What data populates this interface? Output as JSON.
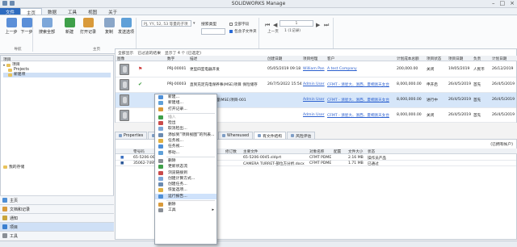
{
  "window": {
    "title": "SOLIDWORKS Manage"
  },
  "menu": [
    "文件",
    "主页",
    "数据",
    "工具",
    "视图",
    "关于"
  ],
  "ribbon": {
    "buttons": [
      {
        "label": "上一步"
      },
      {
        "label": "下一步"
      },
      {
        "label": "搜索全部"
      },
      {
        "label": "新建"
      },
      {
        "label": "打开记录"
      },
      {
        "label": "复制"
      },
      {
        "label": "发送选项"
      }
    ],
    "groups": [
      "导航",
      "主页"
    ],
    "search_value": "PJ, YY, 52, 53 等量的子项",
    "search_type_label": "搜索类型",
    "search_checks": [
      {
        "label": "全部字段",
        "checked": false
      },
      {
        "label": "包含子文件夹",
        "checked": true
      }
    ],
    "prev_next": "上一页",
    "page_input": "1",
    "page_of": "1 (1记录)"
  },
  "left": {
    "header": "项目",
    "tree": [
      {
        "label": "项目"
      },
      {
        "label": "Projects"
      },
      {
        "label": "新建项"
      }
    ],
    "search_fav": "我的存储",
    "nav": [
      {
        "label": "主页"
      },
      {
        "label": "文档和记录"
      },
      {
        "label": "通知"
      },
      {
        "label": "项目"
      },
      {
        "label": "工具"
      }
    ]
  },
  "grid": {
    "filter_label": "全部显示",
    "selected_info": "已过滤的结果",
    "count_info": "显示了 4 个 (已选定)",
    "columns": [
      "图像",
      "",
      "",
      "数字",
      "描述",
      "创建日期",
      "项目经理",
      "客户",
      "计划成本总额",
      "项目状态",
      "项目日期",
      "负责",
      "计划日期"
    ],
    "rows": [
      {
        "num": "PRJ-00001",
        "desc": "更型四室电器开发",
        "created": "05/05/2019 09:18",
        "pm": "William Pan",
        "client": "A test Company",
        "cost": "200,000.00",
        "status": "关闭",
        "date": "19/05/2019",
        "resp": "人民币",
        "plan": "26/12/2019"
      },
      {
        "num": "PRJ-00003",
        "desc": "直到充足充电保养事(MSE)项目 保险储存",
        "created": "26/7/5/2022 15:54",
        "pm": "Admin User",
        "client": "CFMT - 浙星大、浙西、夏桐浙天女台",
        "cost": "8,000,000.00",
        "status": "申开启",
        "date": "26/4/5/2019",
        "resp": "首先",
        "plan": "26/4/5/2019"
      },
      {
        "num": "PRJ-00004",
        "desc": "提供充足充电处理(MSE)项目-001",
        "created": "",
        "pm": "Admin User",
        "client": "CFMT - 浙星大、浙西、夏桐浙天女台",
        "cost": "8,000,000.00",
        "status": "进行中",
        "date": "26/4/5/2019",
        "resp": "首先",
        "plan": "26/4/5/2019"
      },
      {
        "num": "",
        "desc": "",
        "created": "",
        "pm": "Admin User",
        "client": "CFMT - 浙星大、浙西、夏桐浙天女台",
        "cost": "8,000,000.00",
        "status": "关闭",
        "date": "26/4/5/2019",
        "resp": "首先",
        "plan": "26/4/5/2019"
      }
    ]
  },
  "bottom": {
    "tabs": [
      "Properties",
      "Rela",
      "Whereused",
      "有文件结构",
      "风险评估"
    ],
    "right_label": "(已拥有帐户)",
    "columns": [
      "",
      "零号码",
      "",
      "修订数",
      "主要文件",
      "对象名称",
      "配置",
      "文件大小",
      "状态"
    ],
    "rows": [
      {
        "num": "65-5206-0045",
        "rev": "",
        "file": "65-5206-0045.sldprt",
        "obj": "CFMT PDME",
        "cfg": "",
        "size": "2.16 MB",
        "state": "操作员产品"
      },
      {
        "num": "35062-74953",
        "rev": "",
        "file": "CAMERA TURRET-部位方分析.docx",
        "obj": "CFMT PDME",
        "cfg": "",
        "size": "1.71 MB",
        "state": "已通过"
      }
    ]
  },
  "context_menu": [
    {
      "label": "新建..."
    },
    {
      "label": "新建组..."
    },
    {
      "label": "打开记录..."
    },
    {
      "sep": true
    },
    {
      "label": "插入",
      "dis": true
    },
    {
      "label": "检出"
    },
    {
      "label": "取消检出..."
    },
    {
      "label": "添加到“项目视图”的列表..."
    },
    {
      "label": "任务视..."
    },
    {
      "label": "任务视..."
    },
    {
      "label": "移动..."
    },
    {
      "sep": true
    },
    {
      "label": "删除"
    },
    {
      "label": "更新状态流"
    },
    {
      "label": "浏览链接到"
    },
    {
      "label": "创建计算方式..."
    },
    {
      "label": "创建任务..."
    },
    {
      "label": "恢复选项..."
    },
    {
      "label": "运行报告..."
    },
    {
      "sep": true
    },
    {
      "label": "删除"
    },
    {
      "label": "工具",
      "sub": true
    }
  ]
}
